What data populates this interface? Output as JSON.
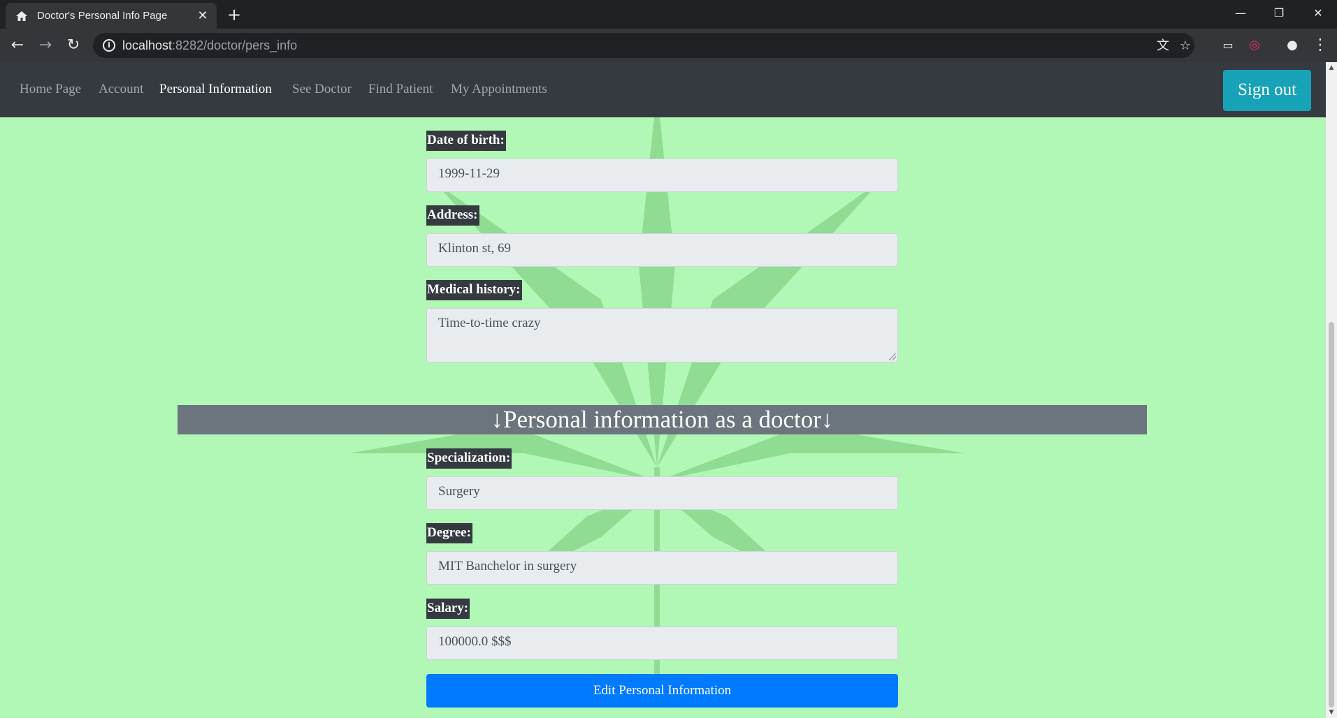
{
  "browser": {
    "tab_title": "Doctor's Personal Info Page",
    "tab_icon": "house-icon",
    "url_host": "localhost",
    "url_path": ":8282/doctor/pers_info"
  },
  "navbar": {
    "links": [
      {
        "label": "Home Page",
        "active": false
      },
      {
        "label": "Account",
        "active": false
      },
      {
        "label": "Personal Information",
        "active": true
      },
      {
        "label": "See Doctor",
        "active": false
      },
      {
        "label": "Find Patient",
        "active": false
      },
      {
        "label": "My Appointments",
        "active": false
      }
    ],
    "sign_out_label": "Sign out"
  },
  "personal": {
    "dob_label": "Date of birth:",
    "dob_value": "1999-11-29",
    "address_label": "Address:",
    "address_value": "Klinton st, 69",
    "medical_history_label": "Medical history:",
    "medical_history_value": "Time-to-time crazy"
  },
  "doctor_section": {
    "header": "↓Personal information as a doctor↓",
    "specialization_label": "Specialization:",
    "specialization_value": "Surgery",
    "degree_label": "Degree:",
    "degree_value": "MIT Banchelor in surgery",
    "salary_label": "Salary:",
    "salary_value": "100000.0 $$$"
  },
  "edit_button_label": "Edit Personal Information",
  "colors": {
    "page_background": "#b1f7b5",
    "navbar": "#343a40",
    "sign_out": "#17a2b8",
    "section_header": "#6c757d",
    "primary_button": "#007bff"
  }
}
